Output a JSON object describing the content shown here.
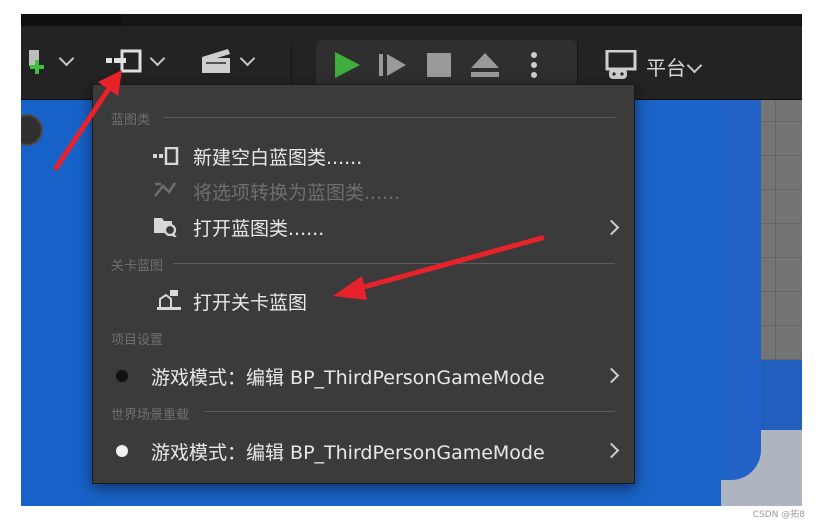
{
  "toolbar": {
    "platform_label": "平台"
  },
  "menu": {
    "sections": [
      {
        "label": "蓝图类"
      },
      {
        "label": "关卡蓝图"
      },
      {
        "label": "项目设置"
      },
      {
        "label": "世界场景重载"
      }
    ],
    "items": [
      {
        "label": "新建空白蓝图类......",
        "icon": "blueprint-class-icon"
      },
      {
        "label": "将选项转换为蓝图类......",
        "icon": "convert-icon",
        "disabled": true
      },
      {
        "label": "打开蓝图类......",
        "icon": "open-folder-icon",
        "submenu": true
      },
      {
        "label": "打开关卡蓝图",
        "icon": "level-blueprint-icon"
      },
      {
        "label": "游戏模式：编辑 BP_ThirdPersonGameMode",
        "icon": "dot-black-icon",
        "submenu": true
      },
      {
        "label": "游戏模式：编辑 BP_ThirdPersonGameMode",
        "icon": "dot-white-icon",
        "submenu": true
      }
    ]
  },
  "watermark": "CSDN @拓8",
  "colors": {
    "arrow": "#e8222a",
    "play_green": "#3fae3f",
    "viewport_blue": "#1a63c7",
    "menu_bg": "#3b3b3b"
  }
}
